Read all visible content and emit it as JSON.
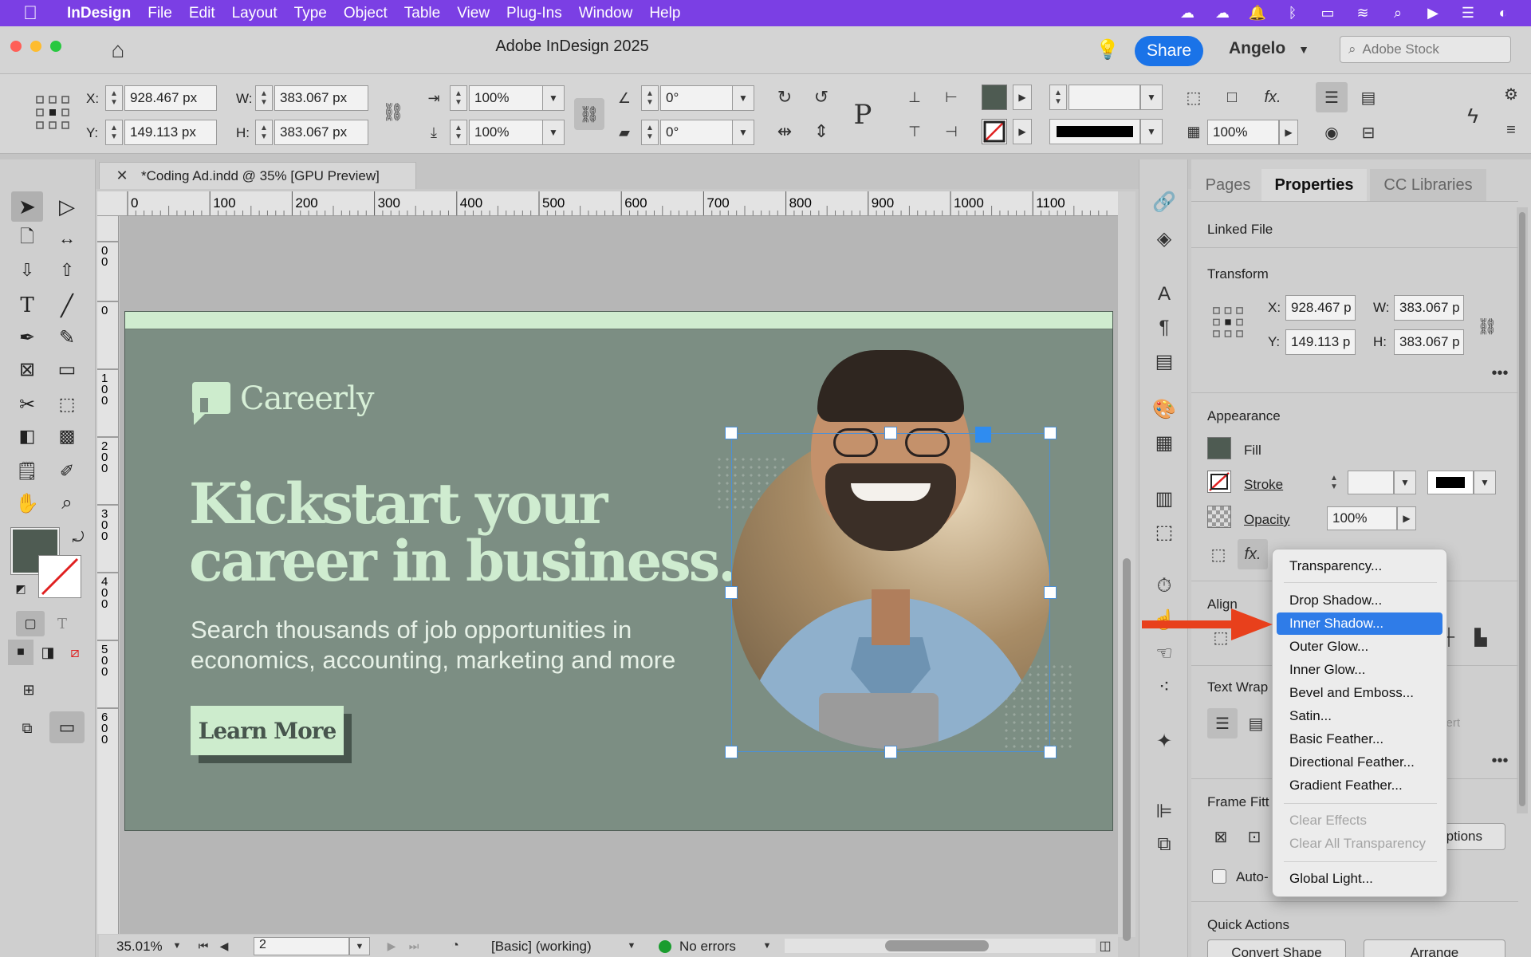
{
  "menubar": {
    "app": "InDesign",
    "items": [
      "File",
      "Edit",
      "Layout",
      "Type",
      "Object",
      "Table",
      "View",
      "Plug-Ins",
      "Window",
      "Help"
    ]
  },
  "titlebar": {
    "title": "Adobe InDesign 2025",
    "share": "Share",
    "user": "Angelo",
    "stock_placeholder": "Adobe Stock"
  },
  "control": {
    "x_label": "X:",
    "y_label": "Y:",
    "w_label": "W:",
    "h_label": "H:",
    "x": "928.467 px",
    "y": "149.113 px",
    "w": "383.067 px",
    "h": "383.067 px",
    "scale_x": "100%",
    "scale_y": "100%",
    "rotate": "0°",
    "shear": "0°",
    "opacity": "100%"
  },
  "document": {
    "tab": "*Coding Ad.indd @ 35% [GPU Preview]"
  },
  "ruler": {
    "h_ticks": [
      "0",
      "100",
      "200",
      "300",
      "400",
      "500",
      "600",
      "700",
      "800",
      "900",
      "1000",
      "1100"
    ],
    "v_ticks": [
      "0\n0",
      "0",
      "1\n0\n0",
      "2\n0\n0",
      "3\n0\n0",
      "4\n0\n0",
      "5\n0\n0",
      "6\n0\n0"
    ]
  },
  "ad": {
    "brand": "Careerly",
    "headline_1": "Kickstart your",
    "headline_2": "career in business.",
    "sub_1": "Search thousands of job opportunities in",
    "sub_2": "economics, accounting, marketing and more",
    "cta": "Learn More"
  },
  "status": {
    "zoom": "35.01%",
    "page": "2",
    "style": "[Basic] (working)",
    "errors": "No errors"
  },
  "panel": {
    "tabs": [
      "Pages",
      "Properties",
      "CC Libraries"
    ],
    "linked_file": "Linked File",
    "transform": "Transform",
    "x_label": "X:",
    "y_label": "Y:",
    "w_label": "W:",
    "h_label": "H:",
    "x": "928.467 p",
    "y": "149.113 p",
    "w": "383.067 p",
    "h": "383.067 p",
    "appearance": "Appearance",
    "fill": "Fill",
    "stroke": "Stroke",
    "opacity_label": "Opacity",
    "opacity": "100%",
    "align": "Align",
    "text_wrap": "Text Wrap",
    "frame_fitting": "Frame Fitt",
    "auto": "Auto-",
    "options": "ptions",
    "quick_actions": "Quick Actions",
    "convert_shape": "Convert Shape",
    "arrange": "Arrange",
    "invert": "vert"
  },
  "fx_menu": {
    "items": [
      "Transparency...",
      "Drop Shadow...",
      "Inner Shadow...",
      "Outer Glow...",
      "Inner Glow...",
      "Bevel and Emboss...",
      "Satin...",
      "Basic Feather...",
      "Directional Feather...",
      "Gradient Feather..."
    ],
    "disabled": [
      "Clear Effects",
      "Clear All Transparency"
    ],
    "last": "Global Light...",
    "highlighted": "Inner Shadow..."
  },
  "colors": {
    "menubar": "#7b3fe4",
    "ad_bg": "#7c8e83",
    "ad_accent": "#cdeccd",
    "highlight": "#2f7ce8",
    "arrow": "#e8401c"
  }
}
